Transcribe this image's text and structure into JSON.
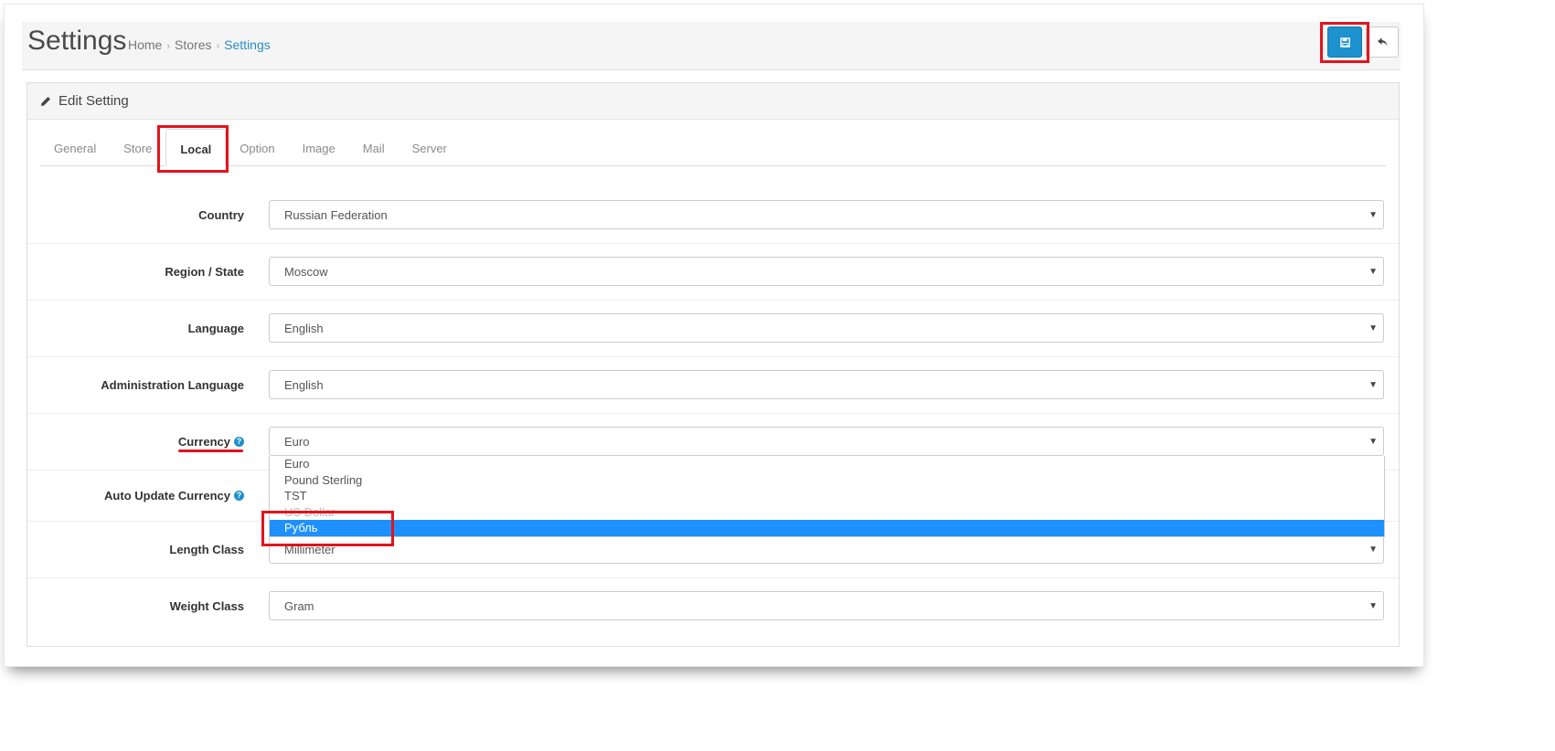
{
  "header": {
    "title": "Settings",
    "breadcrumb": [
      "Home",
      "Stores",
      "Settings"
    ]
  },
  "buttons": {
    "save_icon": "save-icon",
    "back_icon": "reply-icon"
  },
  "panel": {
    "heading": "Edit Setting",
    "heading_icon": "pencil-icon",
    "tabs": [
      "General",
      "Store",
      "Local",
      "Option",
      "Image",
      "Mail",
      "Server"
    ],
    "active_tab": "Local"
  },
  "form": {
    "country": {
      "label": "Country",
      "value": "Russian Federation"
    },
    "region": {
      "label": "Region / State",
      "value": "Moscow"
    },
    "language": {
      "label": "Language",
      "value": "English"
    },
    "admin_language": {
      "label": "Administration Language",
      "value": "English"
    },
    "currency": {
      "label": "Currency",
      "value": "Euro"
    },
    "auto_update_currency": {
      "label": "Auto Update Currency"
    },
    "length_class": {
      "label": "Length Class",
      "value": "Millimeter"
    },
    "weight_class": {
      "label": "Weight Class",
      "value": "Gram"
    }
  },
  "currency_dropdown": {
    "options": [
      "Euro",
      "Pound Sterling",
      "TST",
      "US Dollar",
      "Рубль"
    ],
    "highlighted": "Рубль"
  },
  "colors": {
    "accent": "#1e91cf",
    "annotation": "#e3131c",
    "highlight": "#1e90ff"
  }
}
